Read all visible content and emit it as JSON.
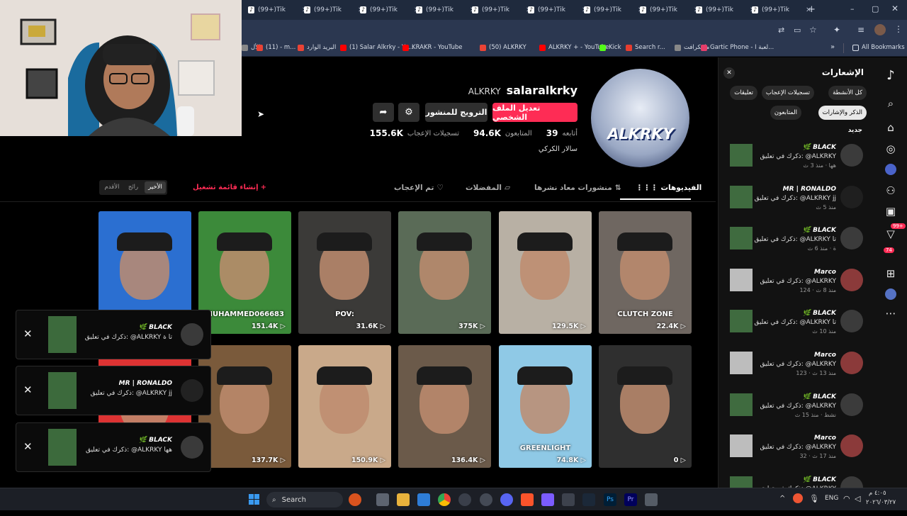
{
  "browser": {
    "tab_title": "(99+)Tik",
    "tab_count": 10,
    "new_tab": "+",
    "bookmarks": [
      {
        "label": "الأل",
        "color": "#888"
      },
      {
        "label": "(11) - m...",
        "color": "#ea4335"
      },
      {
        "label": "البريد الوارد",
        "color": "#ea4335"
      },
      {
        "label": "(1) Salar Alkrky - Yo...",
        "color": "#ff0000"
      },
      {
        "label": "KRAKR - YouTube",
        "color": "#ff0000"
      },
      {
        "label": "(50) ALKRKY",
        "color": "#ea4335"
      },
      {
        "label": "ALKRKY + - YouTube",
        "color": "#ff0000"
      },
      {
        "label": "Kick",
        "color": "#53fc18"
      },
      {
        "label": "Search r...",
        "color": "#e63d2f"
      },
      {
        "label": "ماينكرافت",
        "color": "#888"
      },
      {
        "label": "Gartic Phone - لعبة ا...",
        "color": "#e63d6a"
      }
    ],
    "all_bookmarks": "All Bookmarks"
  },
  "profile": {
    "display_name": "ALKRKY",
    "username": "salaralkrky",
    "bio": "سالار الكركي",
    "following_count": "39",
    "following_label": "أتابعه",
    "followers_count": "94.6K",
    "followers_label": "المتابعون",
    "likes_count": "155.6K",
    "likes_label": "تسجيلات الإعجاب",
    "edit_profile": "تعديل الملف الشخصي",
    "promote_post": "الترويج للمنشور",
    "avatar_text": "ALKRKY"
  },
  "content_tabs": {
    "videos": "الفيديوهات",
    "reposts": "منشورات معاد نشرها",
    "favorites": "المفضلات",
    "liked": "تم الإعجاب",
    "create_playlist": "إنشاء قائمة تشغيل",
    "sort": [
      "الأخير",
      "رائج",
      "الأقدم"
    ]
  },
  "videos": [
    {
      "views": "",
      "bg": "#2b6fd1"
    },
    {
      "views": "151.4K",
      "bg": "#3c8a3a",
      "overlay": "MUHAMMED066683"
    },
    {
      "views": "31.6K",
      "bg": "#3b3a38",
      "overlay": "POV:"
    },
    {
      "views": "375K",
      "bg": "#5a6b57"
    },
    {
      "views": "129.5K",
      "bg": "#b8b0a4"
    },
    {
      "views": "22.4K",
      "bg": "#6f6761",
      "overlay": "CLUTCH ZONE"
    },
    {
      "views": "",
      "bg": "#d33"
    },
    {
      "views": "137.7K",
      "bg": "#7a5a3b"
    },
    {
      "views": "150.9K",
      "bg": "#c9a98a"
    },
    {
      "views": "136.4K",
      "bg": "#6b5a4a"
    },
    {
      "views": "74.8K",
      "bg": "#8fc9e6",
      "overlay": "GREENLIGHT"
    },
    {
      "views": "0",
      "bg": "#2f2f2f"
    }
  ],
  "notifications": {
    "title": "الإشعارات",
    "filters": [
      "كل الأنشطة",
      "تسجيلات الإعجاب",
      "تعليقات",
      "الذكر والإشارات",
      "المتابعون"
    ],
    "section_new": "جديد",
    "items": [
      {
        "name": "🌿 BLACK",
        "text": "ذكرك في تعليق: @ALKRKY",
        "time": "هها · منذ 3 ث"
      },
      {
        "name": "MR | RONALDO",
        "text": "ذكرك في تعليق: @ALKRKY jj",
        "time": "منذ 5 ث"
      },
      {
        "name": "🌿 BLACK",
        "text": "ذكرك في تعليق: @ALKRKY تا",
        "time": "ة · منذ 6 ث"
      },
      {
        "name": "Marco",
        "text": "ذكرك في تعليق: @ALKRKY",
        "time": "124 · منذ 8 ث"
      },
      {
        "name": "🌿 BLACK",
        "text": "ذكرك في تعليق: @ALKRKY تا",
        "time": "منذ 10 ث"
      },
      {
        "name": "Marco",
        "text": "ذكرك في تعليق: @ALKRKY",
        "time": "123 · منذ 13 ث"
      },
      {
        "name": "🌿 BLACK",
        "text": "ذكرك في تعليق: @ALKRKY",
        "time": "نشط · منذ 15 ث"
      },
      {
        "name": "Marco",
        "text": "ذكرك في تعليق: @ALKRKY",
        "time": "32 · منذ 17 ث"
      },
      {
        "name": "🌿 BLACK",
        "text": "ذكرك في تعليق: @ALKRKY",
        "time": ""
      }
    ]
  },
  "nav": {
    "messages_badge": "99+",
    "inbox_badge": "74"
  },
  "toasts": [
    {
      "name": "🌿 BLACK",
      "text": "ذكرك في تعليق: @ALKRKY تا ة"
    },
    {
      "name": "MR | RONALDO",
      "text": "ذكرك في تعليق: @ALKRKY jj"
    },
    {
      "name": "🌿 BLACK",
      "text": "ذكرك في تعليق: @ALKRKY هها"
    }
  ],
  "taskbar": {
    "search": "Search",
    "language": "ENG",
    "time": "٤:٠٥ م",
    "date": "٢٠٢٦/٠٣/٢٧"
  }
}
